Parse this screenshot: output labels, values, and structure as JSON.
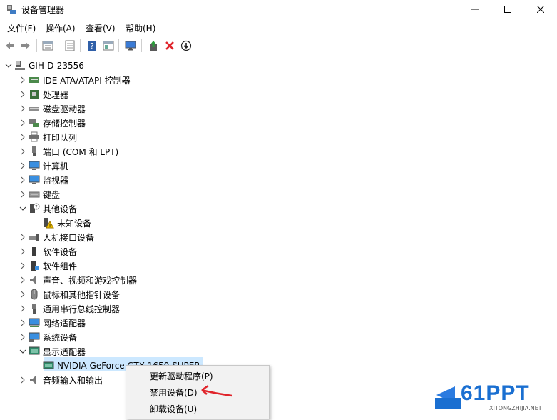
{
  "window": {
    "title": "设备管理器"
  },
  "menu": [
    "文件(F)",
    "操作(A)",
    "查看(V)",
    "帮助(H)"
  ],
  "toolbar": {
    "icons": [
      "back-icon",
      "forward-icon",
      "properties-icon",
      "scan-icon",
      "help-icon",
      "view-icon",
      "monitor-icon",
      "update-driver-icon",
      "uninstall-icon",
      "disable-icon"
    ]
  },
  "tree": {
    "root": "GIH-D-23556",
    "categories": [
      "IDE ATA/ATAPI 控制器",
      "处理器",
      "磁盘驱动器",
      "存储控制器",
      "打印队列",
      "端口 (COM 和 LPT)",
      "计算机",
      "监视器",
      "键盘",
      "其他设备",
      "未知设备",
      "人机接口设备",
      "软件设备",
      "软件组件",
      "声音、视频和游戏控制器",
      "鼠标和其他指针设备",
      "通用串行总线控制器",
      "网络适配器",
      "系统设备",
      "显示适配器",
      "NVIDIA GeForce GTX 1650 SUPER",
      "音频输入和输出"
    ]
  },
  "context_menu": [
    "更新驱动程序(P)",
    "禁用设备(D)",
    "卸载设备(U)"
  ],
  "watermark": {
    "brand": "61PPT",
    "site": "XITONGZHIJIA.NET"
  },
  "colors": {
    "selection": "#cce8ff",
    "accent": "#1a6fd1",
    "arrow": "#e0242b"
  }
}
